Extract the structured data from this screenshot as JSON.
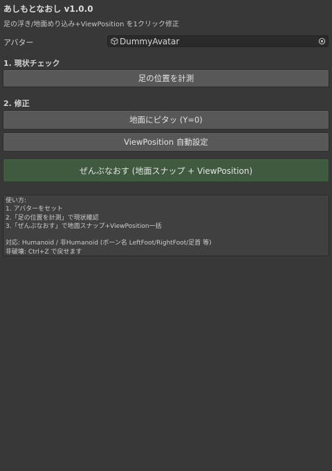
{
  "window": {
    "title": "あしもとなおし v1.0.0",
    "subtitle": "足の浮き/地面めり込み+ViewPosition を1クリック修正"
  },
  "avatar_field": {
    "label": "アバター",
    "value": "DummyAvatar",
    "icon": "cube-icon",
    "picker_icon": "object-picker-icon"
  },
  "section1": {
    "header": "1. 現状チェック",
    "measure_button": "足の位置を計測"
  },
  "section2": {
    "header": "2. 修正",
    "snap_button": "地面にピタッ (Y=0)",
    "viewposition_button": "ViewPosition 自動設定"
  },
  "primary_button": {
    "label": "ぜんぶなおす (地面スナップ + ViewPosition)",
    "color": "#3f5a3f"
  },
  "help": {
    "lines": [
      "使い方:",
      "1. アバターをセット",
      "2.「足の位置を計測」で現状確認",
      "3.「ぜんぶなおす」で地面スナップ+ViewPosition一括",
      "",
      "対応: Humanoid / 非Humanoid (ボーン名 LeftFoot/RightFoot/足首 等)",
      "非破壊: Ctrl+Z で戻せます"
    ]
  },
  "colors": {
    "background": "#383838",
    "button": "#585858",
    "field": "#2a2a2a"
  }
}
